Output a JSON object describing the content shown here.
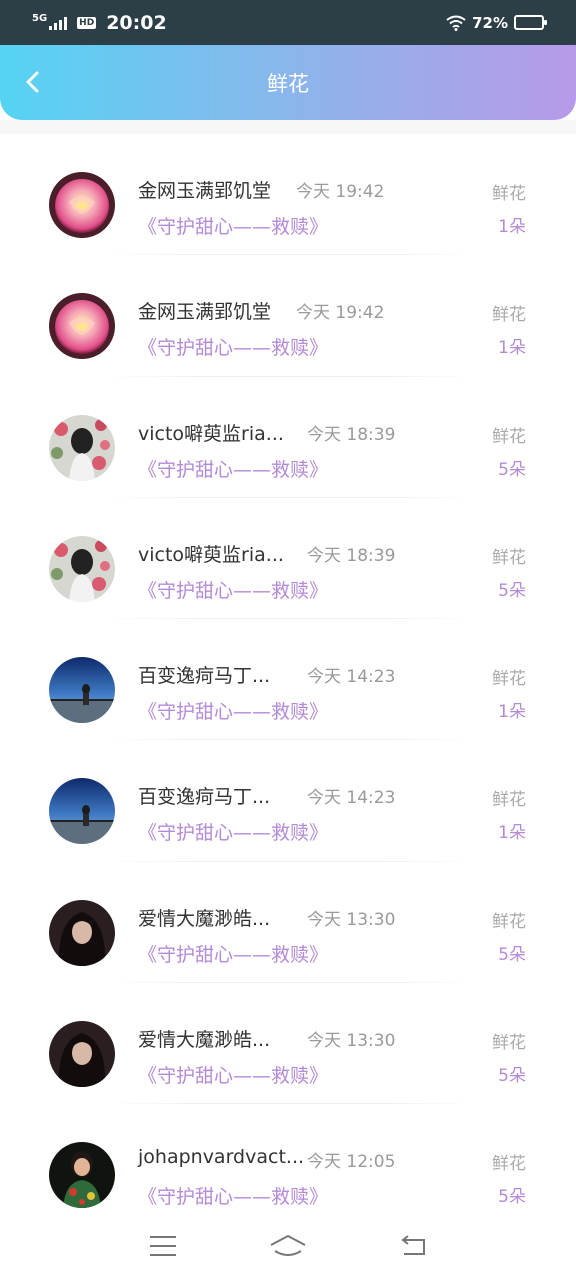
{
  "status_bar": {
    "network": "5G",
    "hd": "HD",
    "time": "20:02",
    "battery_percent": "72%",
    "battery_level": 0.72
  },
  "header": {
    "title": "鲜花",
    "gradient": [
      "#55d3f3",
      "#b79ae9"
    ]
  },
  "colors": {
    "accent": "#b58ad8",
    "muted": "#aaaaaa"
  },
  "items": [
    {
      "name": "金网玉满郢饥堂",
      "time": "今天 19:42",
      "work": "《守护甜心——救赎》",
      "type": "鲜花",
      "count": "1朵",
      "avatar": "rose-avatar"
    },
    {
      "name": "金网玉满郢饥堂",
      "time": "今天 19:42",
      "work": "《守护甜心——救赎》",
      "type": "鲜花",
      "count": "1朵",
      "avatar": "rose-avatar"
    },
    {
      "name": "victo噼萸监ria...",
      "time": "今天 18:39",
      "work": "《守护甜心——救赎》",
      "type": "鲜花",
      "count": "5朵",
      "avatar": "girl-flowers-avatar"
    },
    {
      "name": "victo噼萸监ria...",
      "time": "今天 18:39",
      "work": "《守护甜心——救赎》",
      "type": "鲜花",
      "count": "5朵",
      "avatar": "girl-flowers-avatar"
    },
    {
      "name": "百变逸疴马丁...",
      "time": "今天 14:23",
      "work": "《守护甜心——救赎》",
      "type": "鲜花",
      "count": "1朵",
      "avatar": "anime-sky-avatar"
    },
    {
      "name": "百变逸疴马丁...",
      "time": "今天 14:23",
      "work": "《守护甜心——救赎》",
      "type": "鲜花",
      "count": "1朵",
      "avatar": "anime-sky-avatar"
    },
    {
      "name": "爱情大魔渺皓...",
      "time": "今天 13:30",
      "work": "《守护甜心——救赎》",
      "type": "鲜花",
      "count": "5朵",
      "avatar": "dark-hair-avatar"
    },
    {
      "name": "爱情大魔渺皓...",
      "time": "今天 13:30",
      "work": "《守护甜心——救赎》",
      "type": "鲜花",
      "count": "5朵",
      "avatar": "dark-hair-avatar"
    },
    {
      "name": "johapnvardvact...",
      "time": "今天 12:05",
      "work": "《守护甜心——救赎》",
      "type": "鲜花",
      "count": "5朵",
      "avatar": "qipao-avatar"
    }
  ],
  "nav": [
    "menu-icon",
    "home-icon",
    "back-icon"
  ]
}
